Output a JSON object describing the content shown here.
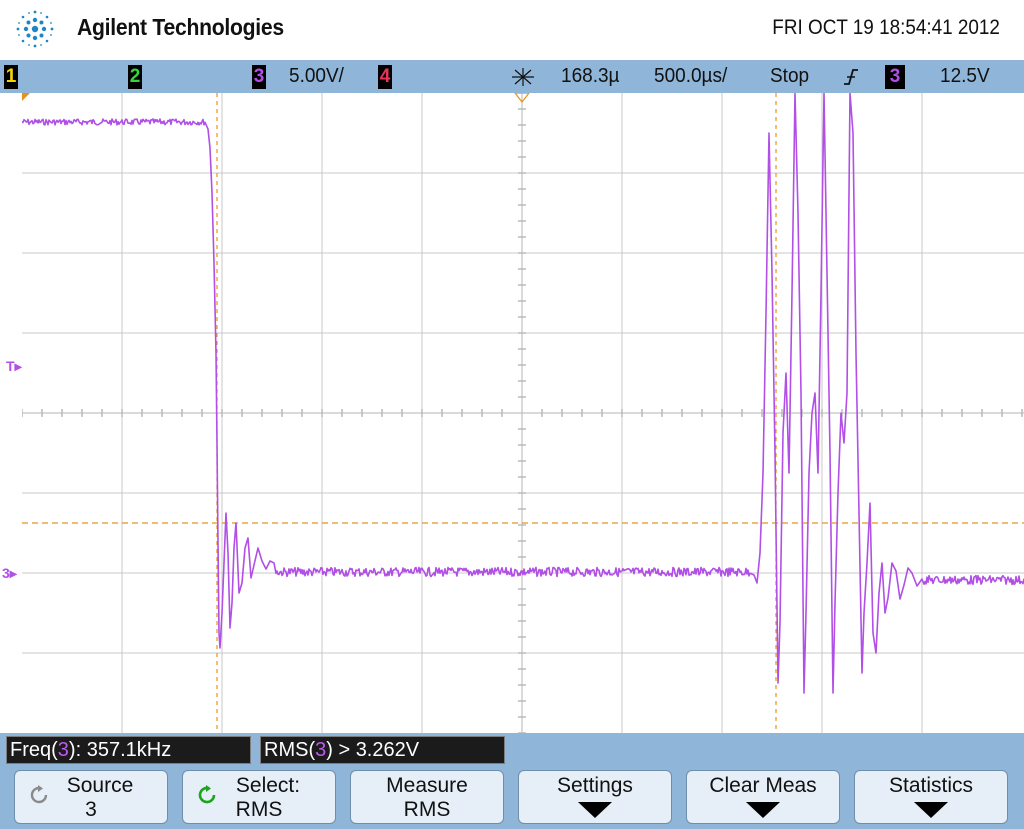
{
  "header": {
    "brand": "Agilent Technologies",
    "datetime": "FRI OCT 19 18:54:41 2012",
    "logo_icon": "agilent-spark-logo"
  },
  "status": {
    "ch1": "1",
    "ch2": "2",
    "ch3": "3",
    "ch3_scale": "5.00V/",
    "ch4": "4",
    "acq_icon": "acquisition-icon",
    "time_delay": "168.3µ",
    "time_delay_unit_note": "s",
    "time_scale": "500.0µs/",
    "run_state": "Stop",
    "trigger_edge_icon": "rising-edge-icon",
    "trigger_source": "3",
    "trigger_level": "12.5V"
  },
  "colors": {
    "ch1": "#f2d600",
    "ch2": "#37d53c",
    "ch3": "#b14fe6",
    "ch4": "#e8325a",
    "cursor": "#e8921e",
    "grid": "#c9c9c9",
    "panel": "#8fb6d9"
  },
  "screen": {
    "trigger_marker": "T",
    "ground_marker": "3"
  },
  "measurements": [
    {
      "name": "Freq(",
      "src": "3",
      "rest": "): 357.1kHz"
    },
    {
      "name": "RMS(",
      "src": "3",
      "rest": ") > 3.262V"
    }
  ],
  "softkeys": [
    {
      "line1": "Source",
      "line2": "3",
      "icon": "rotate-knob-icon"
    },
    {
      "line1": "Select:",
      "line2": "RMS",
      "icon": "rotate-knob-green-icon"
    },
    {
      "line1": "Measure",
      "line2": "RMS"
    },
    {
      "line1": "Settings",
      "has_arrow": true
    },
    {
      "line1": "Clear Meas",
      "has_arrow": true
    },
    {
      "line1": "Statistics",
      "has_arrow": true
    }
  ]
}
